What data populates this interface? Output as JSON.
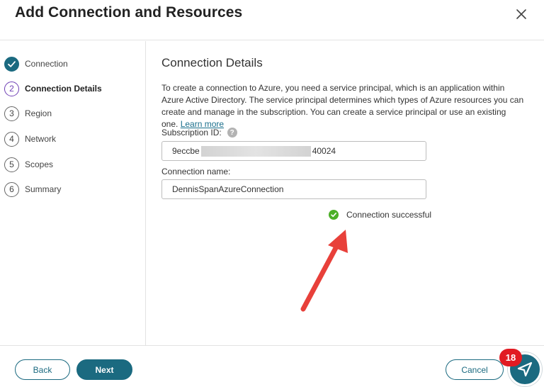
{
  "dialog": {
    "title": "Add Connection and Resources"
  },
  "steps": [
    {
      "number": "",
      "label": "Connection",
      "state": "done"
    },
    {
      "number": "2",
      "label": "Connection Details",
      "state": "active"
    },
    {
      "number": "3",
      "label": "Region",
      "state": "pending"
    },
    {
      "number": "4",
      "label": "Network",
      "state": "pending"
    },
    {
      "number": "5",
      "label": "Scopes",
      "state": "pending"
    },
    {
      "number": "6",
      "label": "Summary",
      "state": "pending"
    }
  ],
  "details": {
    "section_title": "Connection Details",
    "description": "To create a connection to Azure, you need a service principal, which is an application within Azure Active Directory. The service principal determines which types of Azure resources you can create and manage in the subscription. You can create a service principal or use an existing one.",
    "learn_more": "Learn more",
    "subscription_label": "Subscription ID:",
    "subscription_prefix": "9eccbe",
    "subscription_suffix": "40024",
    "connection_name_label": "Connection name:",
    "connection_name_value": "DennisSpanAzureConnection",
    "status_text": "Connection successful"
  },
  "footer": {
    "back_label": "Back",
    "next_label": "Next",
    "cancel_label": "Cancel"
  },
  "fab": {
    "badge_count": "18"
  },
  "colors": {
    "accent": "#1b6a80",
    "active_step": "#6f3fb5",
    "success": "#4caf28",
    "annotation_arrow": "#e8403a",
    "badge": "#e11b22"
  }
}
